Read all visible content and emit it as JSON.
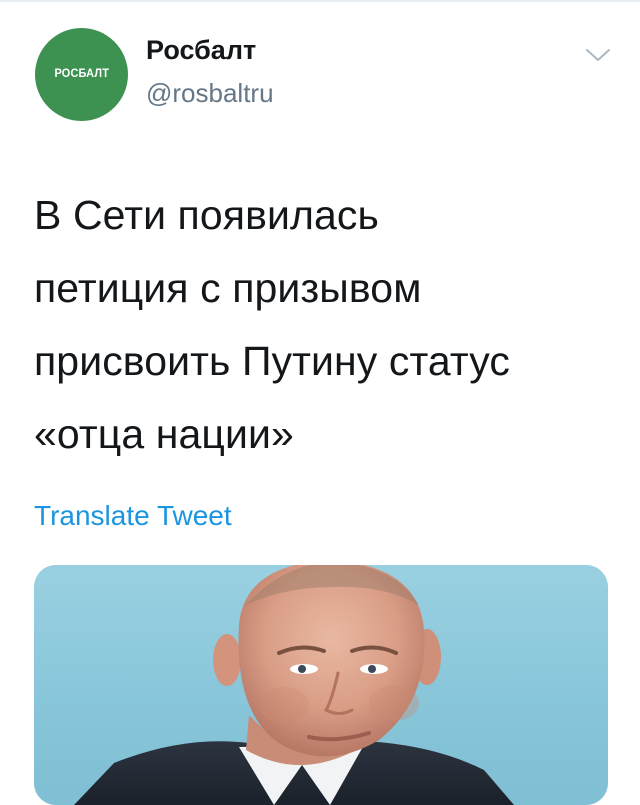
{
  "account": {
    "avatar_text": "РОСБАЛТ",
    "display_name": "Росбалт",
    "handle": "@rosbaltru",
    "avatar_color": "#3d9151",
    "menu_icon": "chevron-down-icon"
  },
  "tweet": {
    "text_lines": [
      "В Сети появилась",
      "петиция с призывом",
      "присвоить Путину статус",
      "«отца нации»"
    ],
    "translate_label": "Translate Tweet",
    "link_color": "#1b95e0"
  },
  "media": {
    "type": "photo",
    "background_color": "#8fcadd"
  }
}
